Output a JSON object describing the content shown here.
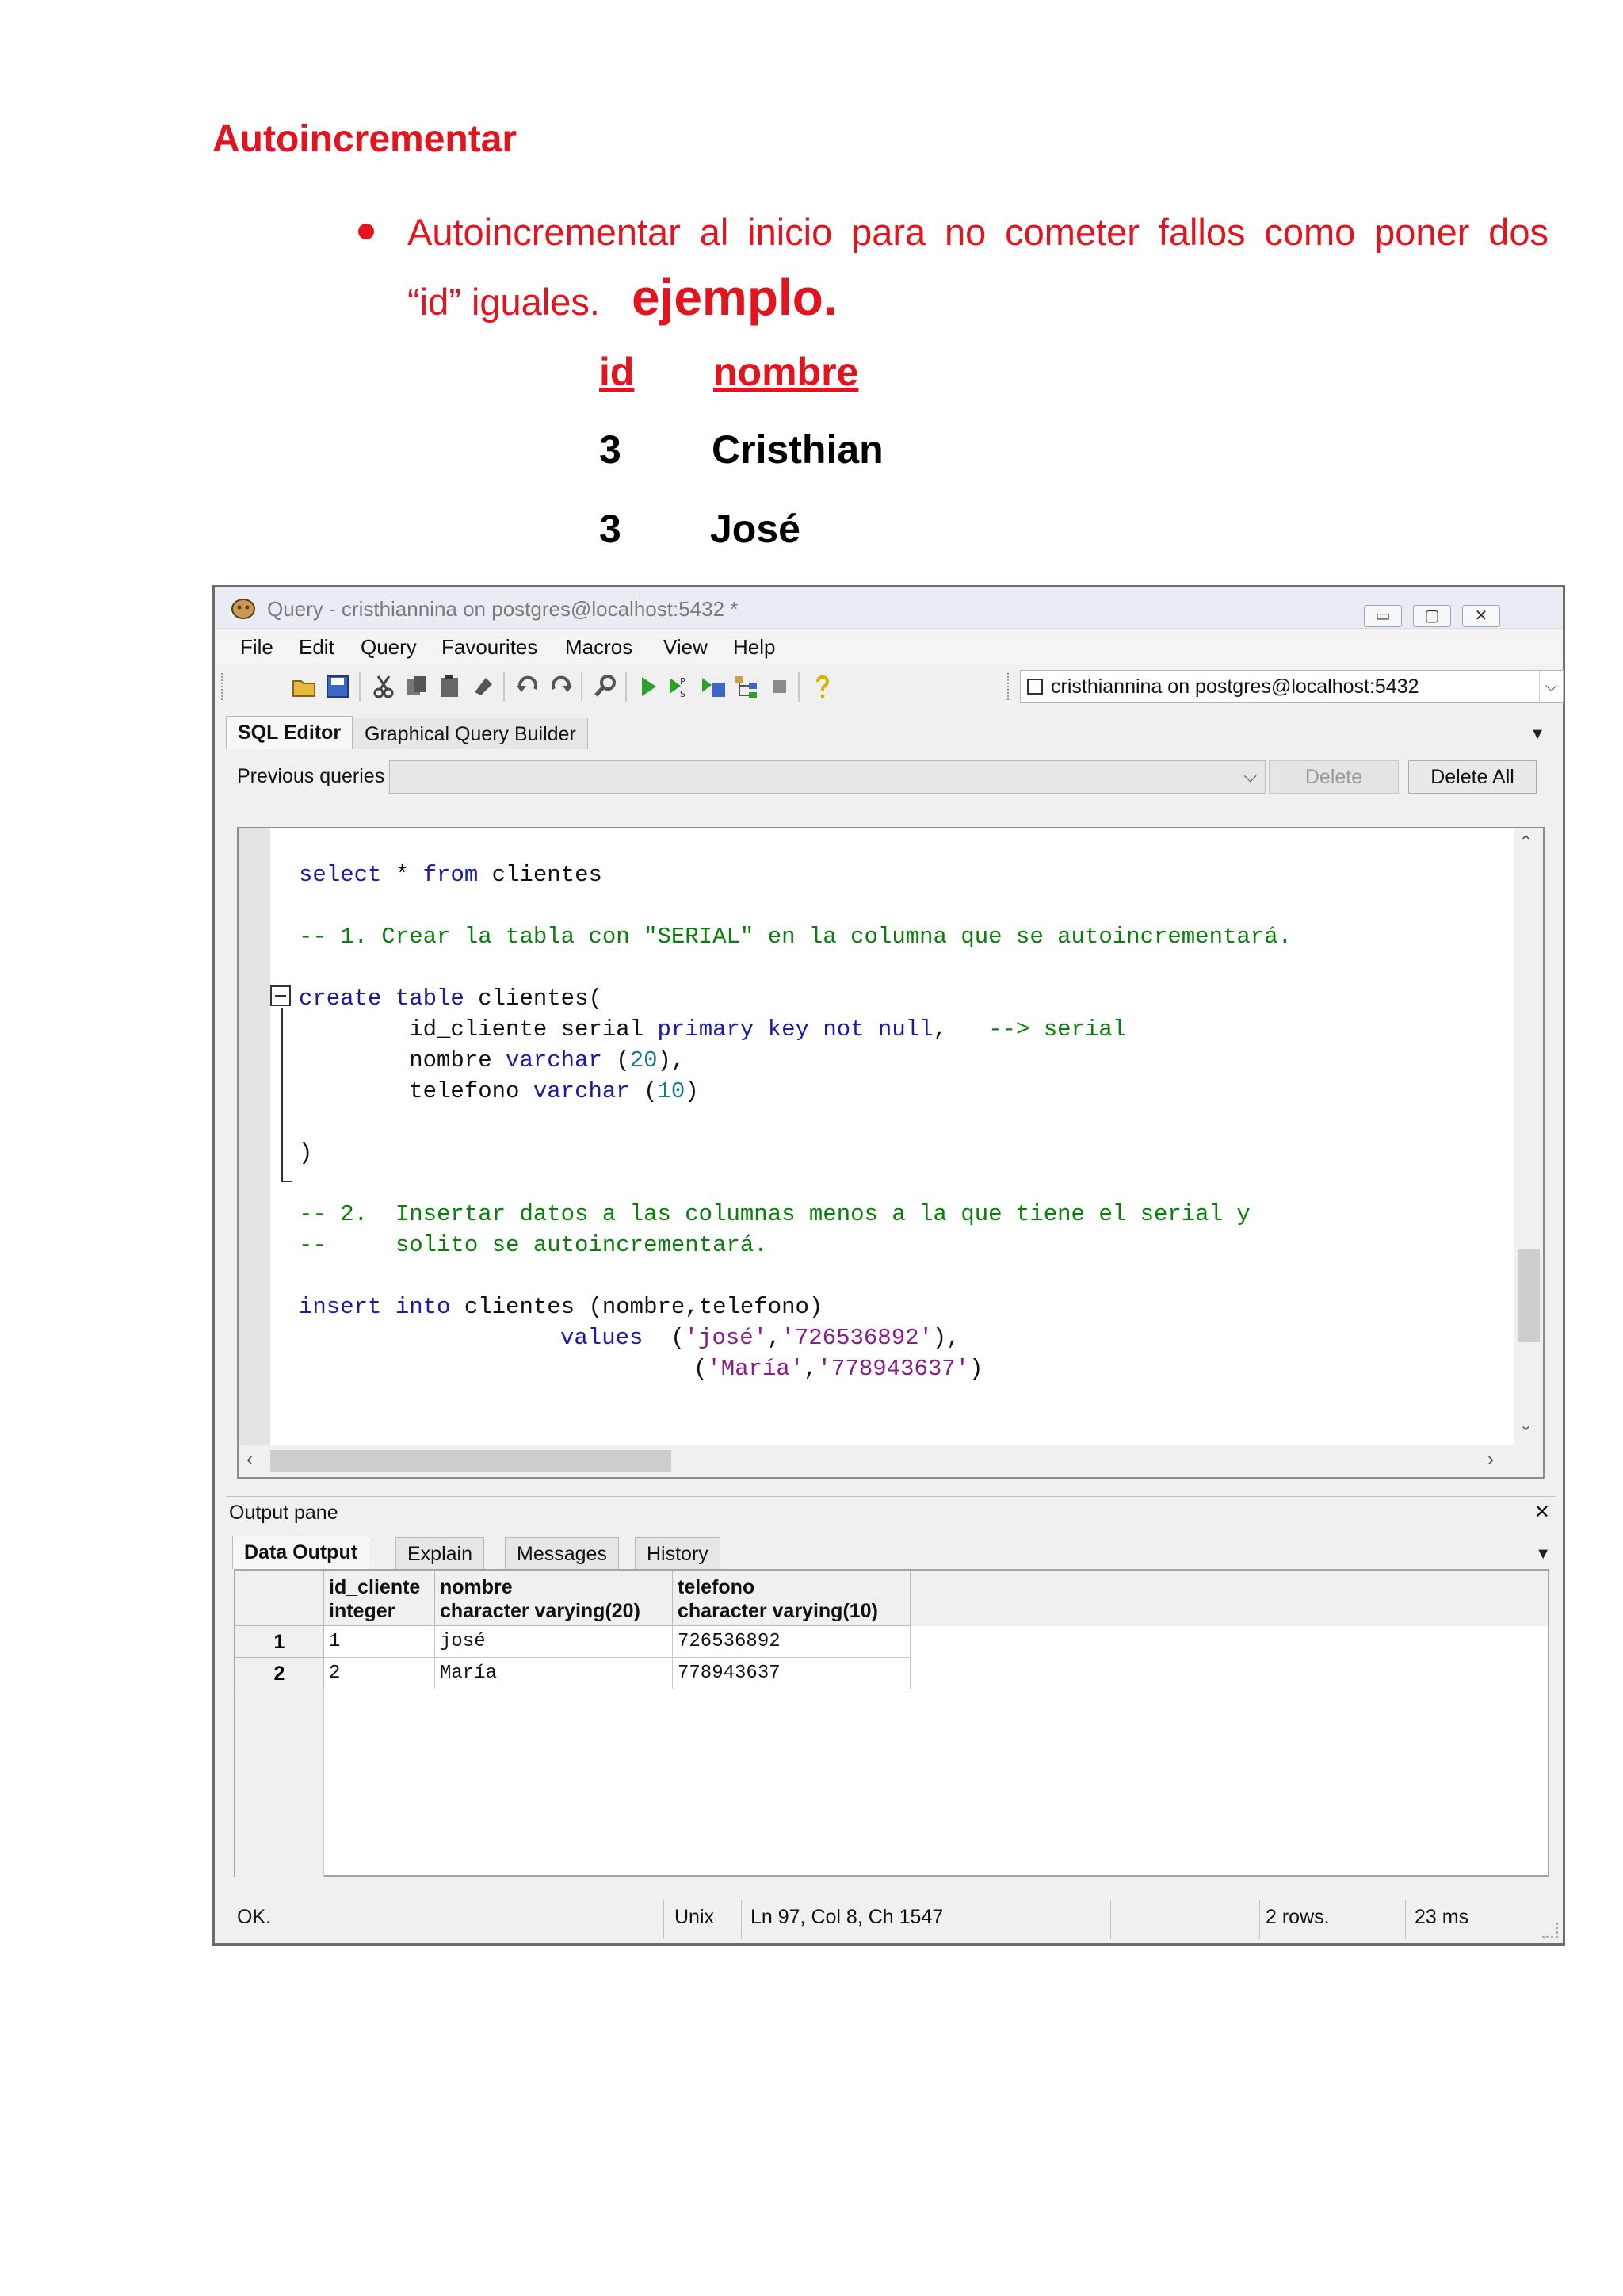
{
  "document": {
    "heading": "Autoincrementar",
    "bullet_text": "Autoincrementar al inicio para no cometer fallos como poner dos",
    "bullet_line2": "“id” iguales.",
    "bullet_emphasis": "ejemplo.",
    "example_table": {
      "headers": [
        "id",
        "nombre"
      ],
      "rows": [
        [
          "3",
          "Cristhian"
        ],
        [
          "3",
          "José"
        ]
      ]
    }
  },
  "window": {
    "title": "Query - cristhiannina on postgres@localhost:5432 *",
    "controls": {
      "minimize": "▭",
      "maximize": "▢",
      "close": "✕"
    },
    "menu": [
      "File",
      "Edit",
      "Query",
      "Favourites",
      "Macros",
      "View",
      "Help"
    ],
    "connection": "cristhiannina on postgres@localhost:5432",
    "editor_tabs": [
      "SQL Editor",
      "Graphical Query Builder"
    ],
    "previous_queries_label": "Previous queries",
    "delete_label": "Delete",
    "delete_all_label": "Delete All",
    "code": {
      "l1_kw1": "select",
      "l1_rest": " * ",
      "l1_kw2": "from",
      "l1_tail": " clientes",
      "l2": "-- 1. Crear la tabla con \"SERIAL\" en la columna que se autoincrementará.",
      "l3_kw": "create table",
      "l3_tail": " clientes(",
      "l4_a": "        id_cliente serial ",
      "l4_kw": "primary key not null",
      "l4_b": ",   ",
      "l4_cm": "--> serial",
      "l5_a": "        nombre ",
      "l5_kw": "varchar",
      "l5_b": " (",
      "l5_num": "20",
      "l5_c": "),",
      "l6_a": "        telefono ",
      "l6_kw": "varchar",
      "l6_b": " (",
      "l6_num": "10",
      "l6_c": ")",
      "l7": ")",
      "l8": "-- 2.  Insertar datos a las columnas menos a la que tiene el serial y",
      "l9": "--     solito se autoincrementará.",
      "l10_kw": "insert into",
      "l10_tail": " clientes (nombre,telefono)",
      "l11_kw": "values",
      "l11_a": "  (",
      "l11_s1": "'josé'",
      "l11_b": ",",
      "l11_s2": "'726536892'",
      "l11_c": "),",
      "l12_a": "(",
      "l12_s1": "'María'",
      "l12_b": ",",
      "l12_s2": "'778943637'",
      "l12_c": ")"
    },
    "output_pane_label": "Output pane",
    "output_tabs": [
      "Data Output",
      "Explain",
      "Messages",
      "History"
    ],
    "result_columns": [
      {
        "name": "id_cliente",
        "type": "integer"
      },
      {
        "name": "nombre",
        "type": "character varying(20)"
      },
      {
        "name": "telefono",
        "type": "character varying(10)"
      }
    ],
    "result_rows": [
      {
        "num": "1",
        "cells": [
          "1",
          "josé",
          "726536892"
        ]
      },
      {
        "num": "2",
        "cells": [
          "2",
          "María",
          "778943637"
        ]
      }
    ],
    "status": {
      "state": "OK.",
      "line_ending": "Unix",
      "position": "Ln 97, Col 8, Ch 1547",
      "rows": "2 rows.",
      "time": "23 ms"
    }
  },
  "colors": {
    "accent_red": "#e3141e",
    "keyword": "#1a1aa6",
    "comment": "#0b7d0b",
    "string": "#8a1b8a"
  }
}
